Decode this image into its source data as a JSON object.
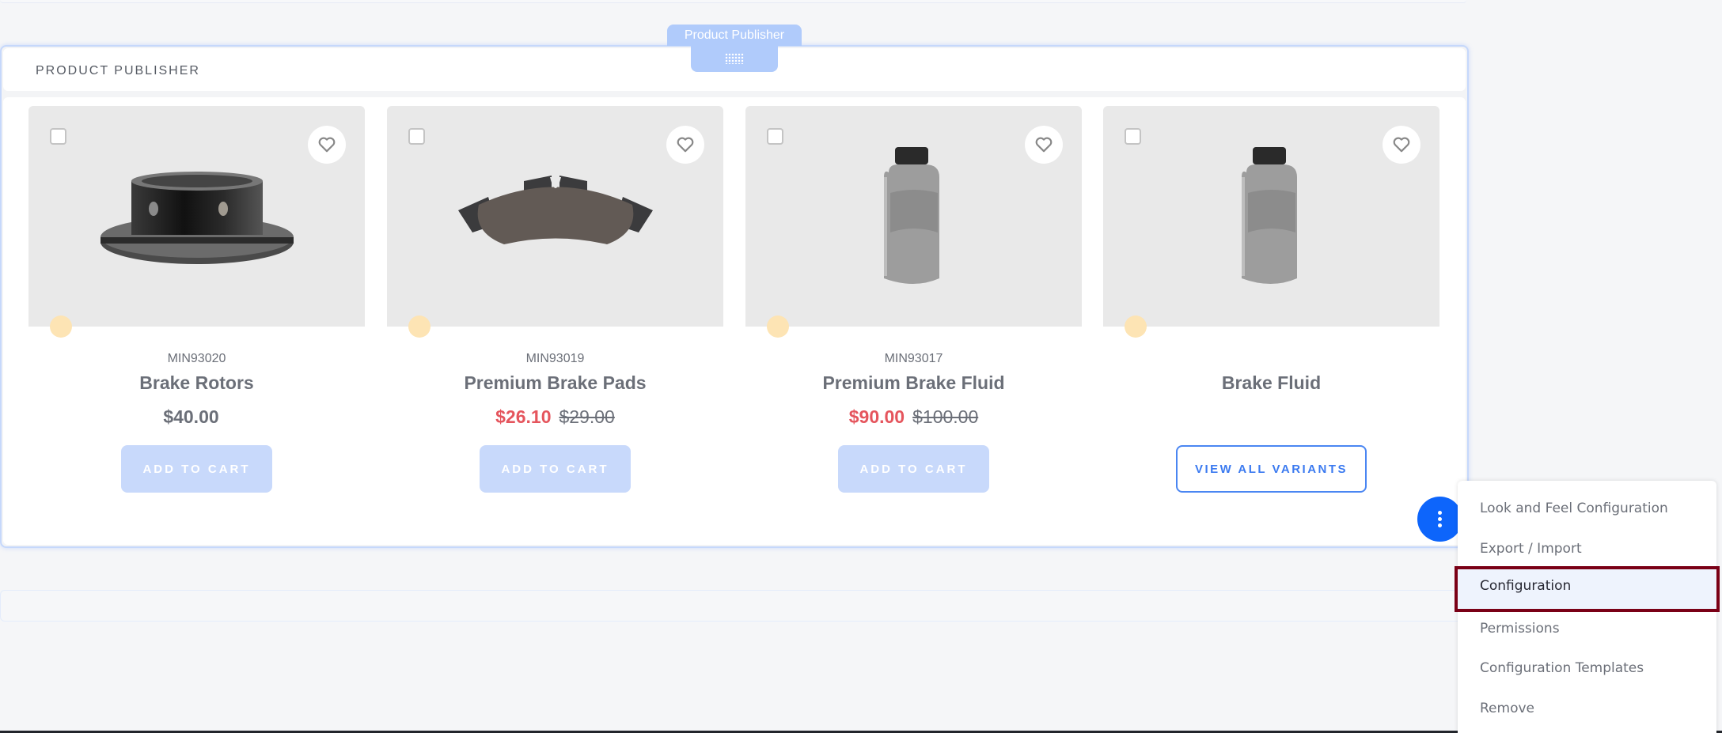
{
  "fragment": {
    "tag_label": "Product Publisher",
    "title": "PRODUCT PUBLISHER",
    "drag_handle_icon": "drag-grid-icon"
  },
  "colors": {
    "accent": "#0d65fb",
    "sale_price": "#e5555d",
    "highlight_border": "#7a0016",
    "button_disabled": "#c8d9fb",
    "badge": "#fde4b4"
  },
  "products": [
    {
      "sku": "MIN93020",
      "name": "Brake Rotors",
      "price": "$40.00",
      "sale_price": null,
      "original_price": null,
      "image": "brake-rotor",
      "action_label": "ADD TO CART",
      "wishlist_icon": "heart-icon"
    },
    {
      "sku": "MIN93019",
      "name": "Premium Brake Pads",
      "price": null,
      "sale_price": "$26.10",
      "original_price": "$29.00",
      "image": "brake-pad",
      "action_label": "ADD TO CART",
      "wishlist_icon": "heart-icon"
    },
    {
      "sku": "MIN93017",
      "name": "Premium Brake Fluid",
      "price": null,
      "sale_price": "$90.00",
      "original_price": "$100.00",
      "image": "fluid-bottle",
      "action_label": "ADD TO CART",
      "wishlist_icon": "heart-icon"
    },
    {
      "sku": "",
      "name": "Brake Fluid",
      "price": null,
      "sale_price": null,
      "original_price": null,
      "image": "fluid-bottle",
      "action_label": "VIEW ALL VARIANTS",
      "wishlist_icon": "heart-icon"
    }
  ],
  "options_menu": {
    "trigger_icon": "vertical-ellipsis-icon",
    "items": [
      {
        "label": "Look and Feel Configuration",
        "active": false
      },
      {
        "label": "Export / Import",
        "active": false
      },
      {
        "label": "Configuration",
        "active": true
      },
      {
        "label": "Permissions",
        "active": false
      },
      {
        "label": "Configuration Templates",
        "active": false
      },
      {
        "label": "Remove",
        "active": false
      }
    ]
  }
}
